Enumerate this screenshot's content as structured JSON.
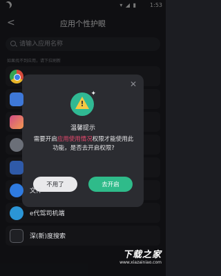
{
  "status_bar": {
    "time": "1:53",
    "system_icons": "▾ ◢ ▮"
  },
  "app_bar": {
    "back_icon": "back-arrow-icon",
    "title": "应用个性护眼"
  },
  "search": {
    "placeholder": "请输入应用名称",
    "value": ""
  },
  "hint": "如果找不到应用，请下拉刷新",
  "apps": [
    {
      "name": "",
      "icon": "chrome-icon"
    },
    {
      "name": "",
      "icon": "person-icon"
    },
    {
      "name": "",
      "icon": "gallery-icon"
    },
    {
      "name": "",
      "icon": "gear-icon"
    },
    {
      "name": "",
      "icon": "blue-app-icon"
    },
    {
      "name": "文件",
      "icon": "folder-icon"
    },
    {
      "name": "e代驾司机端",
      "icon": "edaijia-icon"
    },
    {
      "name": "深(新)度搜索",
      "icon": "deep-search-icon"
    }
  ],
  "dialog": {
    "title": "温馨提示",
    "message_prefix": "需要开启",
    "message_highlight": "应用使用情况",
    "message_suffix": "权限才能使用此功能，是否去开启权限?",
    "cancel_label": "不用了",
    "confirm_label": "去开启",
    "highlight_color": "#e84a6f",
    "confirm_color": "#2fbb8a"
  },
  "watermark": {
    "brand": "下载之家",
    "url": "www.xiazainiao.com"
  }
}
